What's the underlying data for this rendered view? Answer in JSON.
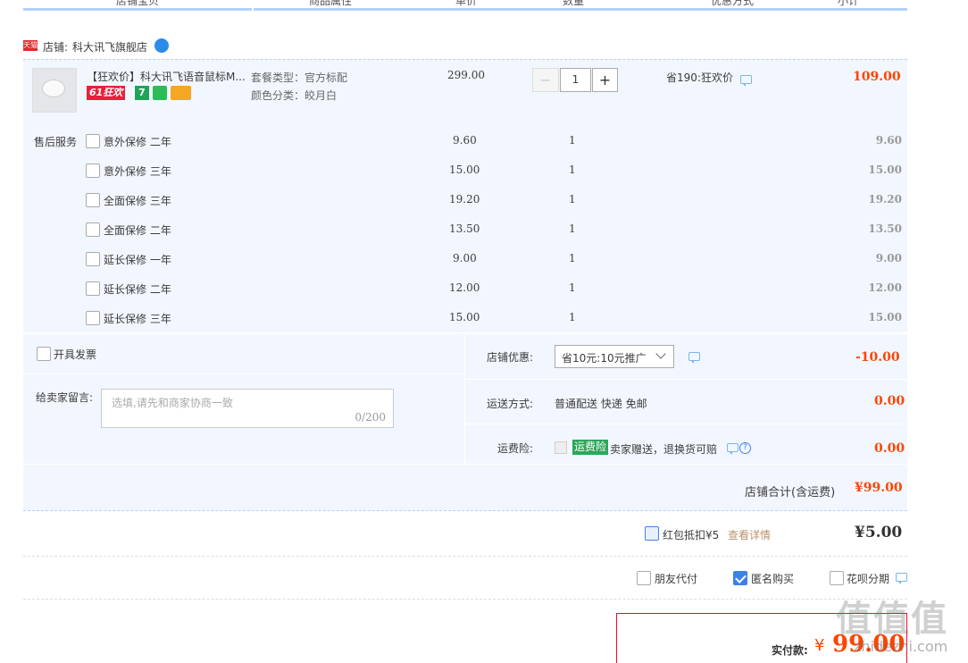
{
  "columns": [
    "店铺宝贝",
    "商品属性",
    "单价",
    "数量",
    "优惠方式",
    "小计"
  ],
  "shop": {
    "badge": "天猫",
    "label": "店铺:",
    "name": "科大讯飞旗舰店"
  },
  "item": {
    "title": "【狂欢价】科大讯飞语音鼠标M...",
    "promo_badge": "61狂欢",
    "badge_7": "7",
    "attr1": "套餐类型：官方标配",
    "attr2": "颜色分类：皎月白",
    "price": "299.00",
    "qty": "1",
    "discount": "省190:狂欢价",
    "subtotal": "109.00"
  },
  "services": {
    "label": "售后服务",
    "items": [
      {
        "name": "意外保修 二年",
        "price": "9.60",
        "qty": "1",
        "subtotal": "9.60"
      },
      {
        "name": "意外保修 三年",
        "price": "15.00",
        "qty": "1",
        "subtotal": "15.00"
      },
      {
        "name": "全面保修 三年",
        "price": "19.20",
        "qty": "1",
        "subtotal": "19.20"
      },
      {
        "name": "全面保修 二年",
        "price": "13.50",
        "qty": "1",
        "subtotal": "13.50"
      },
      {
        "name": "延长保修 一年",
        "price": "9.00",
        "qty": "1",
        "subtotal": "9.00"
      },
      {
        "name": "延长保修 二年",
        "price": "12.00",
        "qty": "1",
        "subtotal": "12.00"
      },
      {
        "name": "延长保修 三年",
        "price": "15.00",
        "qty": "1",
        "subtotal": "15.00"
      }
    ]
  },
  "invoice": {
    "label": "开具发票"
  },
  "message": {
    "label": "给卖家留言:",
    "placeholder": "选填,请先和商家协商一致",
    "counter": "0/200"
  },
  "shop_discount": {
    "label": "店铺优惠:",
    "value": "省10元:10元推广",
    "amount": "-10.00"
  },
  "shipping": {
    "label": "运送方式:",
    "value": "普通配送 快递 免邮",
    "amount": "0.00"
  },
  "insurance": {
    "label": "运费险:",
    "tag": "运费险",
    "desc": "卖家赠送，退换货可赔",
    "amount": "0.00"
  },
  "shop_total": {
    "label": "店铺合计(含运费)",
    "amount": "¥99.00"
  },
  "redpacket": {
    "label": "红包抵扣¥5",
    "link": "查看详情",
    "amount": "¥5.00"
  },
  "options": {
    "friend_pay": "朋友代付",
    "anonymous": "匿名购买",
    "huabei": "花呗分期"
  },
  "pay": {
    "label": "实付款:",
    "currency": "¥",
    "amount": "99.00"
  },
  "watermark": {
    "text": "zhidezhi.com"
  },
  "colors": {
    "accent": "#f40",
    "border_blue": "#b2d1ff",
    "row_bg": "#f2f7ff",
    "checkbox_blue": "#3c82e6"
  }
}
